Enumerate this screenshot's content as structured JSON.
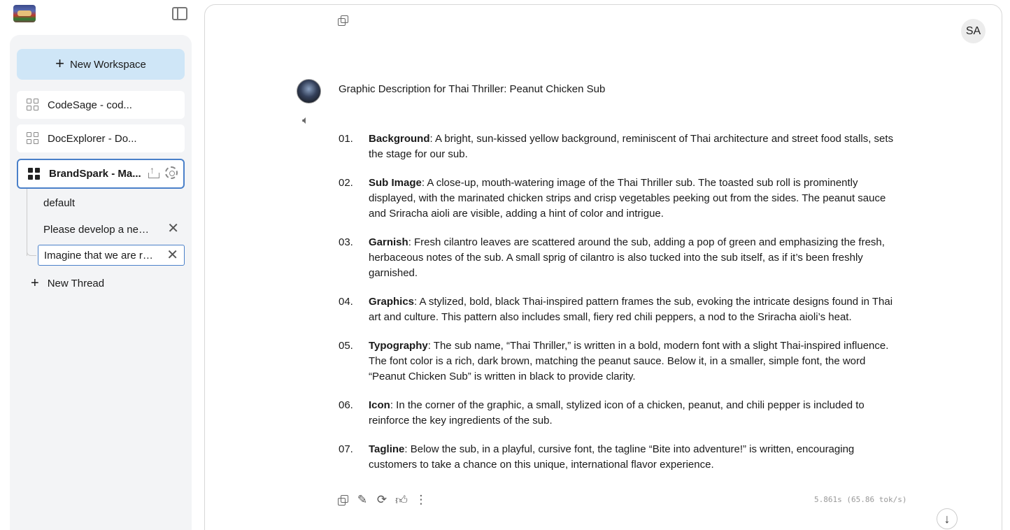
{
  "sidebar": {
    "new_workspace_label": "New Workspace",
    "workspaces": [
      {
        "label": "CodeSage - cod..."
      },
      {
        "label": "DocExplorer - Do..."
      },
      {
        "label": "BrandSpark - Ma..."
      }
    ],
    "threads": [
      {
        "label": "default"
      },
      {
        "label": "Please develop a new j..."
      },
      {
        "label": "Imagine that we are ru..."
      }
    ],
    "new_thread_label": "New Thread"
  },
  "user": {
    "initials": "SA"
  },
  "message": {
    "title": "Graphic Description for Thai Thriller: Peanut Chicken Sub",
    "items": [
      {
        "num": "01.",
        "term": "Background",
        "text": ": A bright, sun-kissed yellow background, reminiscent of Thai architecture and street food stalls, sets the stage for our sub."
      },
      {
        "num": "02.",
        "term": "Sub Image",
        "text": ": A close-up, mouth-watering image of the Thai Thriller sub. The toasted sub roll is prominently displayed, with the marinated chicken strips and crisp vegetables peeking out from the sides. The peanut sauce and Sriracha aioli are visible, adding a hint of color and intrigue."
      },
      {
        "num": "03.",
        "term": "Garnish",
        "text": ": Fresh cilantro leaves are scattered around the sub, adding a pop of green and emphasizing the fresh, herbaceous notes of the sub. A small sprig of cilantro is also tucked into the sub itself, as if it’s been freshly garnished."
      },
      {
        "num": "04.",
        "term": "Graphics",
        "text": ": A stylized, bold, black Thai-inspired pattern frames the sub, evoking the intricate designs found in Thai art and culture. This pattern also includes small, fiery red chili peppers, a nod to the Sriracha aioli’s heat."
      },
      {
        "num": "05.",
        "term": "Typography",
        "text": ": The sub name, “Thai Thriller,” is written in a bold, modern font with a slight Thai-inspired influence. The font color is a rich, dark brown, matching the peanut sauce. Below it, in a smaller, simple font, the word “Peanut Chicken Sub” is written in black to provide clarity."
      },
      {
        "num": "06.",
        "term": "Icon",
        "text": ": In the corner of the graphic, a small, stylized icon of a chicken, peanut, and chili pepper is included to reinforce the key ingredients of the sub."
      },
      {
        "num": "07.",
        "term": "Tagline",
        "text": ": Below the sub, in a playful, cursive font, the tagline “Bite into adventure!” is written, encouraging customers to take a chance on this unique, international flavor experience."
      }
    ],
    "stats": "5.861s (65.86 tok/s)"
  },
  "icons": {
    "copy": "copy-icon",
    "edit": "pencil-icon",
    "regenerate": "refresh-icon",
    "like": "thumbs-up-icon",
    "more": "more-vertical-icon",
    "speaker": "speaker-icon",
    "scroll_down": "arrow-down-icon"
  }
}
